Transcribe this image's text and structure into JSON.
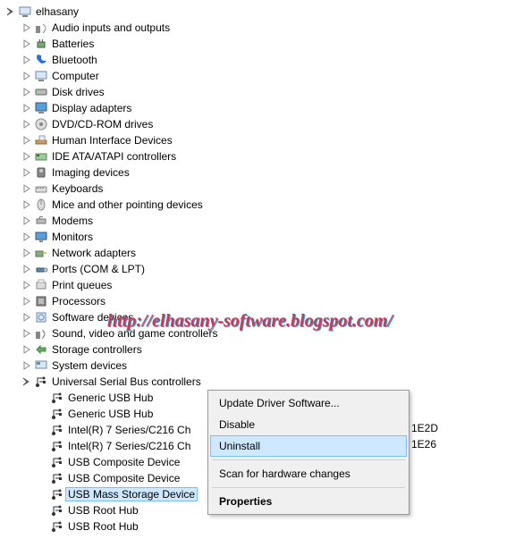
{
  "root": {
    "label": "elhasany"
  },
  "categories": [
    "Audio inputs and outputs",
    "Batteries",
    "Bluetooth",
    "Computer",
    "Disk drives",
    "Display adapters",
    "DVD/CD-ROM drives",
    "Human Interface Devices",
    "IDE ATA/ATAPI controllers",
    "Imaging devices",
    "Keyboards",
    "Mice and other pointing devices",
    "Modems",
    "Monitors",
    "Network adapters",
    "Ports (COM & LPT)",
    "Print queues",
    "Processors",
    "Software devices",
    "Sound, video and game controllers",
    "Storage controllers",
    "System devices"
  ],
  "usb_category": {
    "label": "Universal Serial Bus controllers"
  },
  "usb_children_before": [
    "Generic USB Hub",
    "Generic USB Hub"
  ],
  "usb_children_truncated": [
    {
      "prefix": "Intel(R) 7 Series/C216 Ch",
      "suffix": "1E2D"
    },
    {
      "prefix": "Intel(R) 7 Series/C216 Ch",
      "suffix": "1E26"
    }
  ],
  "usb_children_after": [
    "USB Composite Device",
    "USB Composite Device"
  ],
  "usb_selected": "USB Mass Storage Device",
  "usb_children_last": [
    "USB Root Hub",
    "USB Root Hub"
  ],
  "context_menu": {
    "update": "Update Driver Software...",
    "disable": "Disable",
    "uninstall": "Uninstall",
    "scan": "Scan for hardware changes",
    "properties": "Properties"
  },
  "watermark": "http://elhasany-software.blogspot.com/"
}
